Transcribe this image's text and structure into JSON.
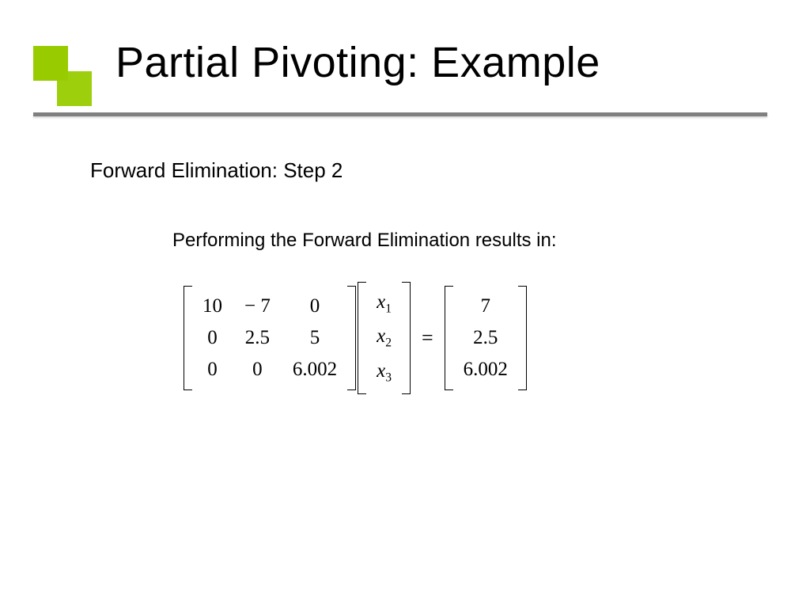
{
  "title": "Partial Pivoting: Example",
  "subtitle": "Forward Elimination: Step 2",
  "bodytext": "Performing the Forward Elimination results in:",
  "matrixA": {
    "r0": {
      "c0": "10",
      "c1": "− 7",
      "c2": "0"
    },
    "r1": {
      "c0": "0",
      "c1": "2.5",
      "c2": "5"
    },
    "r2": {
      "c0": "0",
      "c1": "0",
      "c2": "6.002"
    }
  },
  "vectorX": {
    "r0": {
      "base": "x",
      "sub": "1"
    },
    "r1": {
      "base": "x",
      "sub": "2"
    },
    "r2": {
      "base": "x",
      "sub": "3"
    }
  },
  "eqSign": "=",
  "vectorB": {
    "r0": "7",
    "r1": "2.5",
    "r2": "6.002"
  }
}
